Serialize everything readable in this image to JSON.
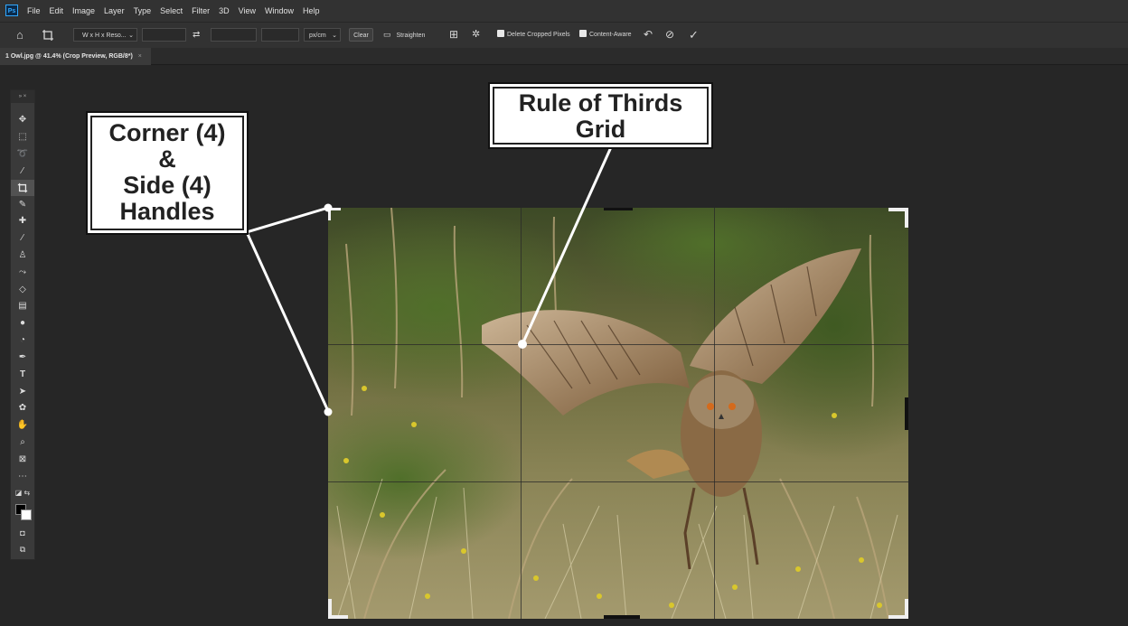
{
  "menubar": {
    "logo": "Ps",
    "items": [
      "File",
      "Edit",
      "Image",
      "Layer",
      "Type",
      "Select",
      "Filter",
      "3D",
      "View",
      "Window",
      "Help"
    ]
  },
  "options_bar": {
    "ratio_select": "W x H x Reso...",
    "units_select": "px/cm",
    "clear_label": "Clear",
    "straighten_label": "Straighten",
    "delete_cropped_label": "Delete Cropped Pixels",
    "delete_cropped_checked": true,
    "content_aware_label": "Content-Aware",
    "content_aware_checked": true
  },
  "document_tab": {
    "title": "1 Owl.jpg @ 41.4% (Crop Preview, RGB/8*)",
    "close": "×"
  },
  "toolbar": {
    "collapse": "» ×",
    "tools": [
      "move",
      "marquee",
      "lasso",
      "magic-wand",
      "crop",
      "eyedropper",
      "healing",
      "brush",
      "stamp",
      "history-brush",
      "eraser",
      "gradient",
      "blur",
      "dodge",
      "pen",
      "type",
      "path-select",
      "shape",
      "hand",
      "zoom",
      "frame",
      "more"
    ],
    "active_tool": "crop",
    "foreground_color": "#000000",
    "background_color": "#ffffff"
  },
  "annotations": {
    "handles_callout": [
      "Corner (4)",
      "&",
      "Side (4)",
      "Handles"
    ],
    "grid_callout": [
      "Rule of Thirds",
      "Grid"
    ]
  },
  "colors": {
    "app_background": "#262626",
    "panel": "#323232",
    "accent": "#31a8ff"
  }
}
